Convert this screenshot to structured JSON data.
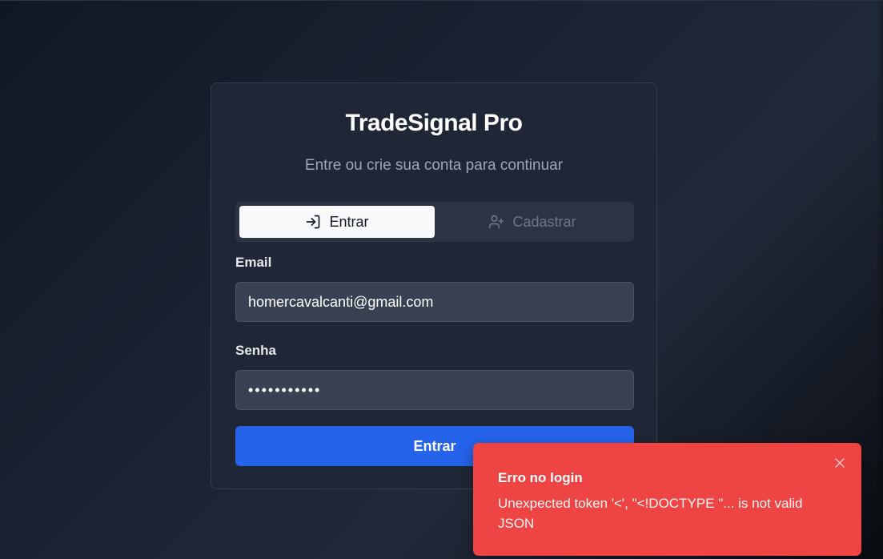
{
  "app": {
    "title": "TradeSignal Pro",
    "subtitle": "Entre ou crie sua conta para continuar"
  },
  "tabs": [
    {
      "label": "Entrar",
      "icon": "login-icon",
      "active": true
    },
    {
      "label": "Cadastrar",
      "icon": "user-plus-icon",
      "active": false
    }
  ],
  "form": {
    "email_label": "Email",
    "email_value": "homercavalcanti@gmail.com",
    "password_label": "Senha",
    "password_value": "•••••••••••",
    "submit_label": "Entrar"
  },
  "toast": {
    "title": "Erro no login",
    "message": "Unexpected token '<', \"<!DOCTYPE \"... is not valid JSON",
    "close_icon": "close-icon"
  },
  "colors": {
    "card_bg": "#1f2736",
    "primary_button": "#2563eb",
    "toast_bg": "#ef4444",
    "active_tab_bg": "#f9fafb"
  }
}
